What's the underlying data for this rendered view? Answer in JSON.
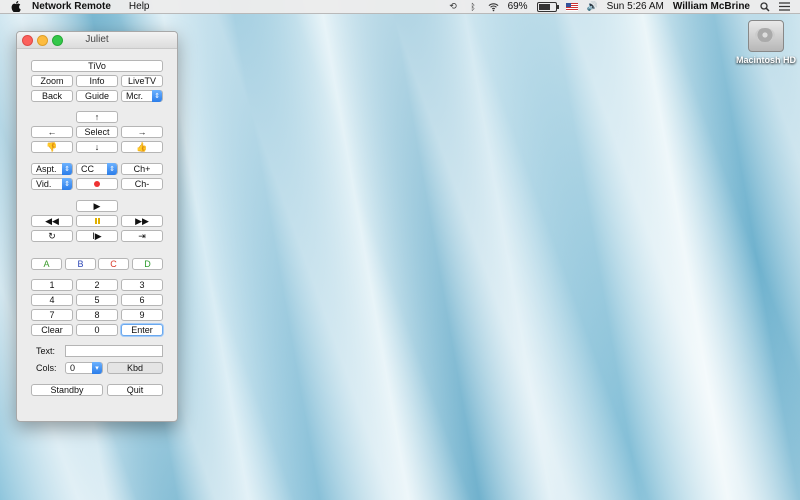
{
  "menubar": {
    "app_name": "Network Remote",
    "menus": [
      "Help"
    ],
    "battery_pct": "69%",
    "battery_level": 0.69,
    "clock": "Sun 5:26 AM",
    "user": "William McBrine"
  },
  "desktop": {
    "drive_label": "Macintosh HD"
  },
  "window": {
    "title": "Juliet"
  },
  "remote": {
    "tivo": "TiVo",
    "zoom": "Zoom",
    "info": "Info",
    "livetv": "LiveTV",
    "back": "Back",
    "guide": "Guide",
    "mcr_select": "Mcr.",
    "up": "↑",
    "left": "←",
    "select": "Select",
    "right": "→",
    "down": "↓",
    "aspect_select": "Aspt.",
    "cc_select": "CC",
    "ch_up": "Ch+",
    "video_select": "Vid.",
    "ch_down": "Ch-",
    "play": "▶",
    "reverse": "◀◀",
    "forward": "▶▶",
    "replay": "↻",
    "slow": "I▶",
    "advance": "⇥",
    "a": "A",
    "b": "B",
    "c": "C",
    "d": "D",
    "num1": "1",
    "num2": "2",
    "num3": "3",
    "num4": "4",
    "num5": "5",
    "num6": "6",
    "num7": "7",
    "num8": "8",
    "num9": "9",
    "clear": "Clear",
    "num0": "0",
    "enter": "Enter",
    "text_label": "Text:",
    "text_value": "",
    "cols_label": "Cols:",
    "cols_value": "0",
    "kbd": "Kbd",
    "standby": "Standby",
    "quit": "Quit"
  },
  "colors": {
    "a": "#3a9a2a",
    "b": "#2a44b5",
    "c": "#d83a2a",
    "d": "#2a9a2a"
  }
}
